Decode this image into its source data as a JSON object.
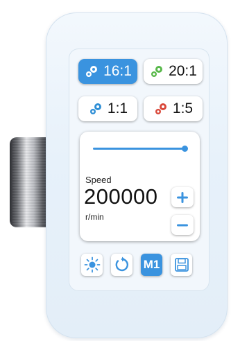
{
  "ratios": [
    {
      "label": "16:1",
      "gear_color": "#ffffff",
      "active": true
    },
    {
      "label": "20:1",
      "gear_color": "#58b84a",
      "active": false
    },
    {
      "label": "1:1",
      "gear_color": "#2f8fd6",
      "active": false
    },
    {
      "label": "1:5",
      "gear_color": "#d9483a",
      "active": false
    }
  ],
  "speed": {
    "label": "Speed",
    "value": "200000",
    "unit": "r/min",
    "slider_level": 1.0
  },
  "toolbar": {
    "memory_label": "M1",
    "icons": [
      "brightness-icon",
      "reverse-icon",
      "memory-m1-button",
      "save-icon"
    ]
  },
  "colors": {
    "accent": "#3a93df",
    "body": "#e7f1fa"
  }
}
